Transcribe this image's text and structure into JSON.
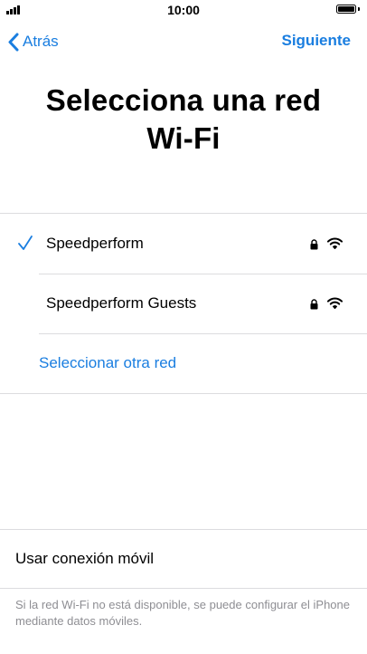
{
  "status_bar": {
    "time": "10:00"
  },
  "nav": {
    "back_label": "Atrás",
    "next_label": "Siguiente"
  },
  "title": "Selecciona una red Wi-Fi",
  "networks": [
    {
      "name": "Speedperform",
      "selected": true,
      "secured": true
    },
    {
      "name": "Speedperform Guests",
      "selected": false,
      "secured": true
    }
  ],
  "other_network_label": "Seleccionar otra red",
  "mobile_data_label": "Usar conexión móvil",
  "footnote": "Si la red Wi-Fi no está disponible, se puede configurar el iPhone mediante datos móviles.",
  "colors": {
    "accent": "#1a7ee0",
    "separator": "#dcdcdf",
    "secondary_text": "#8e8e93"
  },
  "icons": {
    "back": "chevron-left-icon",
    "check": "checkmark-icon",
    "lock": "lock-icon",
    "wifi": "wifi-icon"
  }
}
